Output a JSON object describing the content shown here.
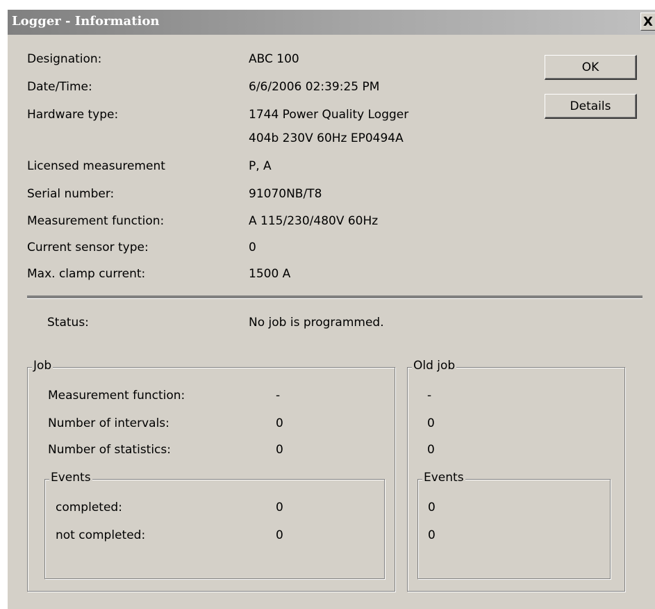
{
  "window": {
    "title": "Logger - Information",
    "close_label": "X"
  },
  "info": [
    {
      "label": "Designation:",
      "value": "ABC 100"
    },
    {
      "label": "Date/Time:",
      "value": "6/6/2006 02:39:25 PM"
    },
    {
      "label": "Hardware type:",
      "value": "1744 Power Quality Logger",
      "value2": "404b 230V 60Hz EP0494A"
    },
    {
      "label": "Licensed measurement",
      "value": "P, A"
    },
    {
      "label": "Serial number:",
      "value": "91070NB/T8"
    },
    {
      "label": "Measurement function:",
      "value": "A 115/230/480V 60Hz"
    },
    {
      "label": "Current sensor type:",
      "value": "0"
    },
    {
      "label": "Max. clamp current:",
      "value": "1500 A"
    }
  ],
  "buttons": {
    "ok": "OK",
    "details": "Details"
  },
  "status": {
    "label": "Status:",
    "value": "No job is programmed."
  },
  "job": {
    "title": "Job",
    "rows": [
      {
        "label": "Measurement function:",
        "value": "-"
      },
      {
        "label": "Number of intervals:",
        "value": "0"
      },
      {
        "label": "Number of statistics:",
        "value": "0"
      }
    ],
    "events": {
      "title": "Events",
      "rows": [
        {
          "label": "completed:",
          "value": "0"
        },
        {
          "label": "not completed:",
          "value": "0"
        }
      ]
    }
  },
  "old_job": {
    "title": "Old job",
    "values": [
      "-",
      "0",
      "0"
    ],
    "events": {
      "title": "Events",
      "values": [
        "0",
        "0"
      ]
    }
  }
}
